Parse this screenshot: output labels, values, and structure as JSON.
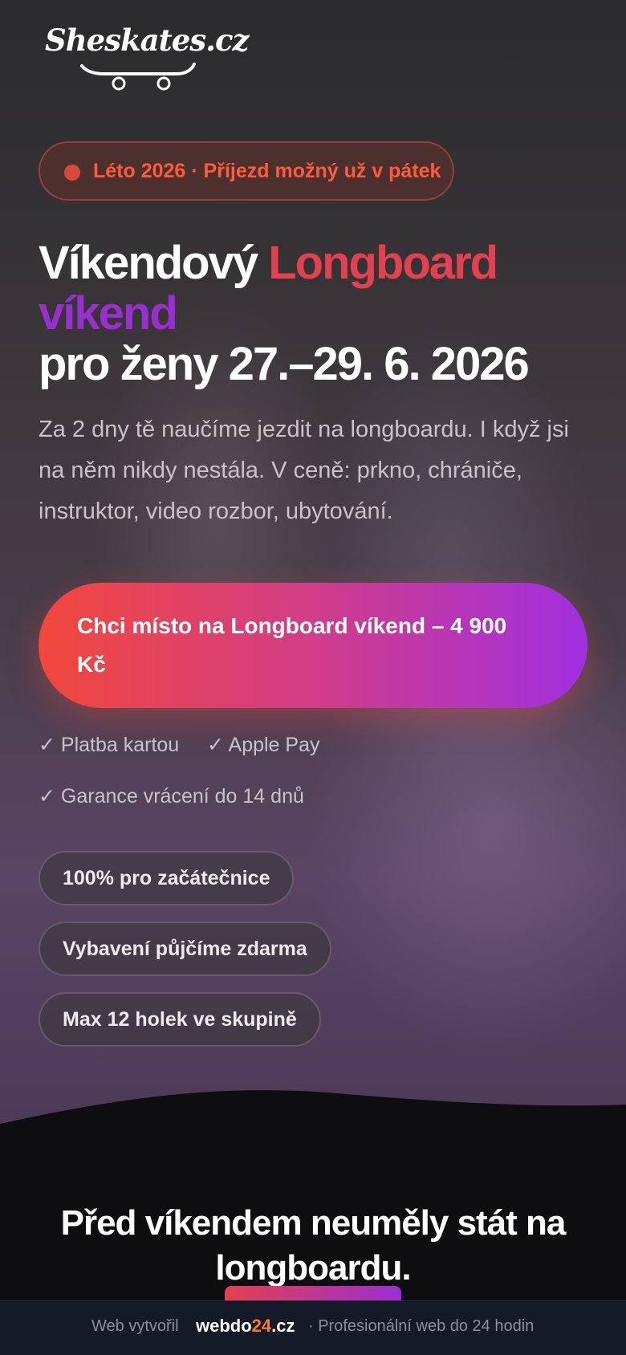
{
  "header": {
    "logo_text": "Sheskates.cz"
  },
  "hero": {
    "badge": "Léto 2026 · Příjezd možný už v pátek",
    "headline": {
      "part1": "Víkendový ",
      "part2": "Longboard",
      "part3": "víkend",
      "part4": "pro ženy 27.–29. 6. 2026"
    },
    "description": "Za 2 dny tě naučíme jezdit na longboardu. I když jsi na něm nikdy nestála. V ceně: prkno, chrániče, instruktor, video rozbor, ubytování.",
    "cta_label": "Chci místo na Longboard víkend – 4 900 Kč",
    "trust": {
      "card": "✓ Platba kartou",
      "apple_pay": "✓ Apple Pay",
      "refund": "✓ Garance vrácení do 14 dnů"
    },
    "chips": [
      "100% pro začátečnice",
      "Vybavení půjčíme zdarma",
      "Max 12 holek ve skupině"
    ]
  },
  "section2": {
    "title": "Před víkendem neuměly stát na longboardu."
  },
  "footer": {
    "label": "Web vytvořil",
    "brand_a": "webdo",
    "brand_num": "24",
    "brand_b": ".cz",
    "tagline": "· Profesionální web do 24 hodin"
  },
  "colors": {
    "accent_red": "#f2483c",
    "accent_pink": "#d13d88",
    "accent_purple": "#a030e0",
    "background": "#0e0e10",
    "footer_bg": "#151a28"
  }
}
